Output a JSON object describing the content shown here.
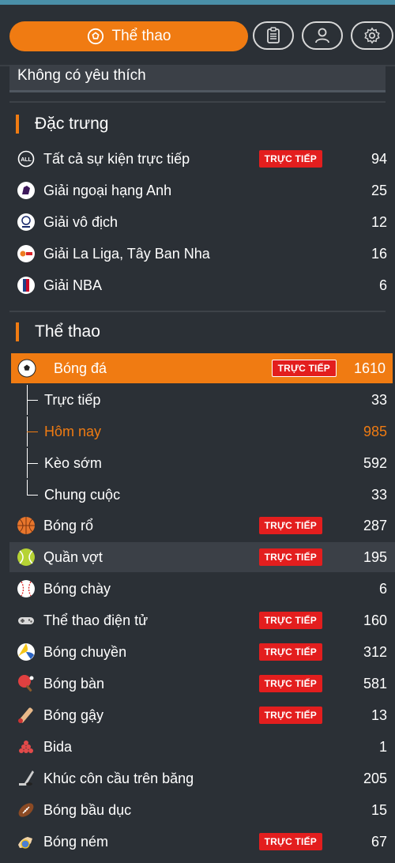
{
  "tabs": {
    "main_label": "Thể thao",
    "icons": [
      "clipboard-icon",
      "user-icon",
      "gear-icon"
    ]
  },
  "favorites_empty": "Không có yêu thích",
  "featured": {
    "title": "Đặc trưng",
    "items": [
      {
        "label": "Tất cả sự kiện trực tiếp",
        "badge": "TRỰC TIẾP",
        "count": "94",
        "icon": "all-icon"
      },
      {
        "label": "Giải ngoại hạng Anh",
        "count": "25",
        "icon": "premier-league-icon"
      },
      {
        "label": "Giải vô địch",
        "count": "12",
        "icon": "champions-league-icon"
      },
      {
        "label": "Giải La Liga, Tây Ban Nha",
        "count": "16",
        "icon": "laliga-icon"
      },
      {
        "label": "Giải NBA",
        "count": "6",
        "icon": "nba-icon"
      }
    ]
  },
  "sports": {
    "title": "Thể thao",
    "football": {
      "label": "Bóng đá",
      "badge": "TRỰC TIẾP",
      "count": "1610"
    },
    "sub": [
      {
        "label": "Trực tiếp",
        "count": "33"
      },
      {
        "label": "Hôm nay",
        "count": "985"
      },
      {
        "label": "Kèo sớm",
        "count": "592"
      },
      {
        "label": "Chung cuộc",
        "count": "33"
      }
    ],
    "items": [
      {
        "label": "Bóng rổ",
        "badge": "TRỰC TIẾP",
        "count": "287",
        "icon": "basketball-icon"
      },
      {
        "label": "Quần vợt",
        "badge": "TRỰC TIẾP",
        "count": "195",
        "icon": "tennis-ball-icon"
      },
      {
        "label": "Bóng chày",
        "count": "6",
        "icon": "baseball-icon"
      },
      {
        "label": "Thể thao điện tử",
        "badge": "TRỰC TIẾP",
        "count": "160",
        "icon": "gamepad-icon"
      },
      {
        "label": "Bóng chuyền",
        "badge": "TRỰC TIẾP",
        "count": "312",
        "icon": "volleyball-icon"
      },
      {
        "label": "Bóng bàn",
        "badge": "TRỰC TIẾP",
        "count": "581",
        "icon": "table-tennis-icon"
      },
      {
        "label": "Bóng gậy",
        "badge": "TRỰC TIẾP",
        "count": "13",
        "icon": "cricket-icon"
      },
      {
        "label": "Bida",
        "count": "1",
        "icon": "billiards-icon"
      },
      {
        "label": "Khúc côn cầu trên băng",
        "count": "205",
        "icon": "ice-hockey-icon"
      },
      {
        "label": "Bóng bầu dục",
        "count": "15",
        "icon": "rugby-ball-icon"
      },
      {
        "label": "Bóng ném",
        "badge": "TRỰC TIẾP",
        "count": "67",
        "icon": "handball-icon"
      }
    ]
  },
  "colors": {
    "accent": "#f07b12",
    "live_badge": "#e31e1e",
    "background": "#2b3036"
  }
}
